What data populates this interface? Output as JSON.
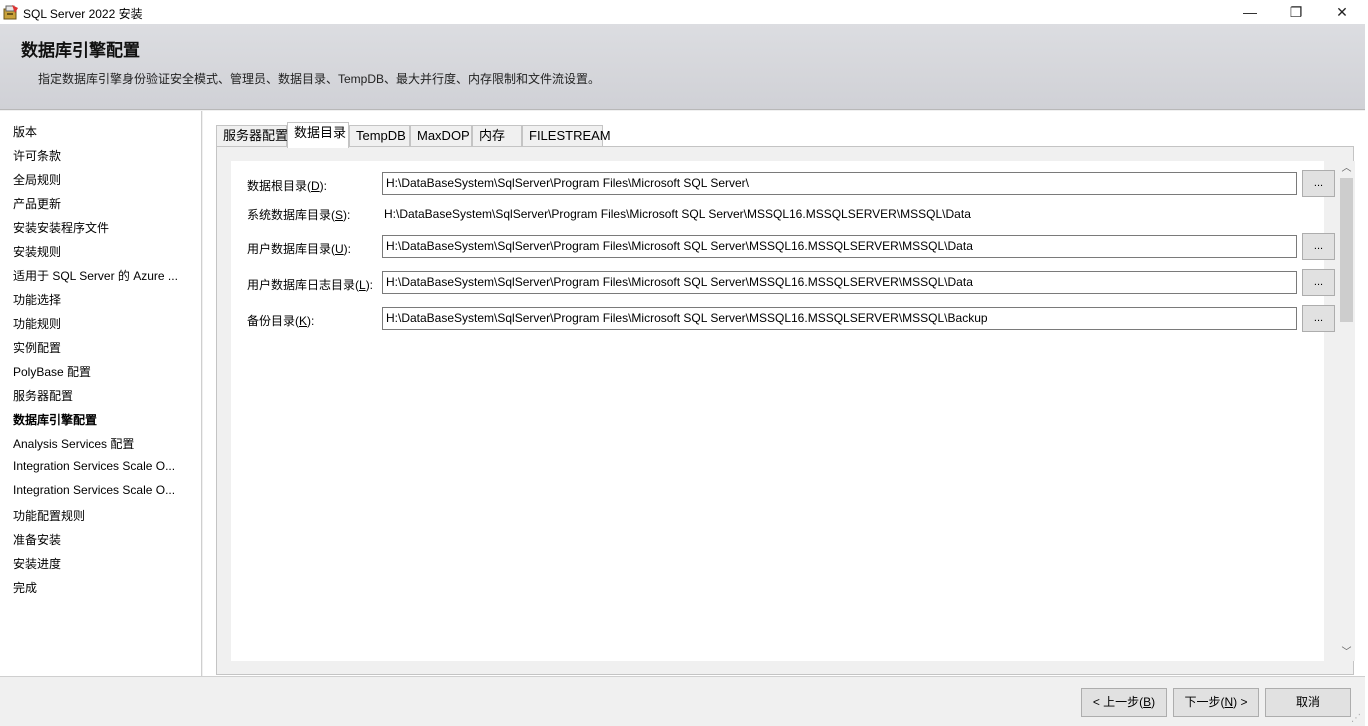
{
  "window": {
    "title": "SQL Server 2022 安装",
    "icon": "sql-setup-icon",
    "controls": {
      "minimize": "—",
      "maximize": "❐",
      "close": "✕"
    }
  },
  "header": {
    "title": "数据库引擎配置",
    "description": "指定数据库引擎身份验证安全模式、管理员、数据目录、TempDB、最大并行度、内存限制和文件流设置。"
  },
  "nav": {
    "items": [
      {
        "label": "版本",
        "active": false
      },
      {
        "label": "许可条款",
        "active": false
      },
      {
        "label": "全局规则",
        "active": false
      },
      {
        "label": "产品更新",
        "active": false
      },
      {
        "label": "安装安装程序文件",
        "active": false
      },
      {
        "label": "安装规则",
        "active": false
      },
      {
        "label": "适用于 SQL Server 的 Azure ...",
        "active": false
      },
      {
        "label": "功能选择",
        "active": false
      },
      {
        "label": "功能规则",
        "active": false
      },
      {
        "label": "实例配置",
        "active": false
      },
      {
        "label": "PolyBase 配置",
        "active": false
      },
      {
        "label": "服务器配置",
        "active": false
      },
      {
        "label": "数据库引擎配置",
        "active": true
      },
      {
        "label": "Analysis Services 配置",
        "active": false
      },
      {
        "label": "Integration Services Scale O...",
        "active": false
      },
      {
        "label": "Integration Services Scale O...",
        "active": false
      },
      {
        "label": "功能配置规则",
        "active": false
      },
      {
        "label": "准备安装",
        "active": false
      },
      {
        "label": "安装进度",
        "active": false
      },
      {
        "label": "完成",
        "active": false
      }
    ]
  },
  "tabs": [
    {
      "label": "服务器配置",
      "active": false
    },
    {
      "label": "数据目录",
      "active": true
    },
    {
      "label": "TempDB",
      "active": false
    },
    {
      "label": "MaxDOP",
      "active": false
    },
    {
      "label": "内存",
      "active": false
    },
    {
      "label": "FILESTREAM",
      "active": false
    }
  ],
  "data_dirs": {
    "root": {
      "label_pre": "数据根目录(",
      "hotkey": "D",
      "label_post": "):",
      "value": "H:\\DataBaseSystem\\SqlServer\\Program Files\\Microsoft SQL Server\\"
    },
    "system": {
      "label_pre": "系统数据库目录(",
      "hotkey": "S",
      "label_post": "):",
      "value": "H:\\DataBaseSystem\\SqlServer\\Program Files\\Microsoft SQL Server\\MSSQL16.MSSQLSERVER\\MSSQL\\Data"
    },
    "user_db": {
      "label_pre": "用户数据库目录(",
      "hotkey": "U",
      "label_post": "):",
      "value": "H:\\DataBaseSystem\\SqlServer\\Program Files\\Microsoft SQL Server\\MSSQL16.MSSQLSERVER\\MSSQL\\Data"
    },
    "user_log": {
      "label_pre": "用户数据库日志目录(",
      "hotkey": "L",
      "label_post": "):",
      "value": "H:\\DataBaseSystem\\SqlServer\\Program Files\\Microsoft SQL Server\\MSSQL16.MSSQLSERVER\\MSSQL\\Data"
    },
    "backup": {
      "label_pre": "备份目录(",
      "hotkey": "K",
      "label_post": "):",
      "value": "H:\\DataBaseSystem\\SqlServer\\Program Files\\Microsoft SQL Server\\MSSQL16.MSSQLSERVER\\MSSQL\\Backup"
    },
    "browse_label": "..."
  },
  "scrollbar": {
    "up": "︿",
    "down": "﹀"
  },
  "footer": {
    "back": {
      "pre": "< 上一步(",
      "hotkey": "B",
      "post": ")"
    },
    "next": {
      "pre": "下一步(",
      "hotkey": "N",
      "post": ") >"
    },
    "cancel": "取消"
  }
}
